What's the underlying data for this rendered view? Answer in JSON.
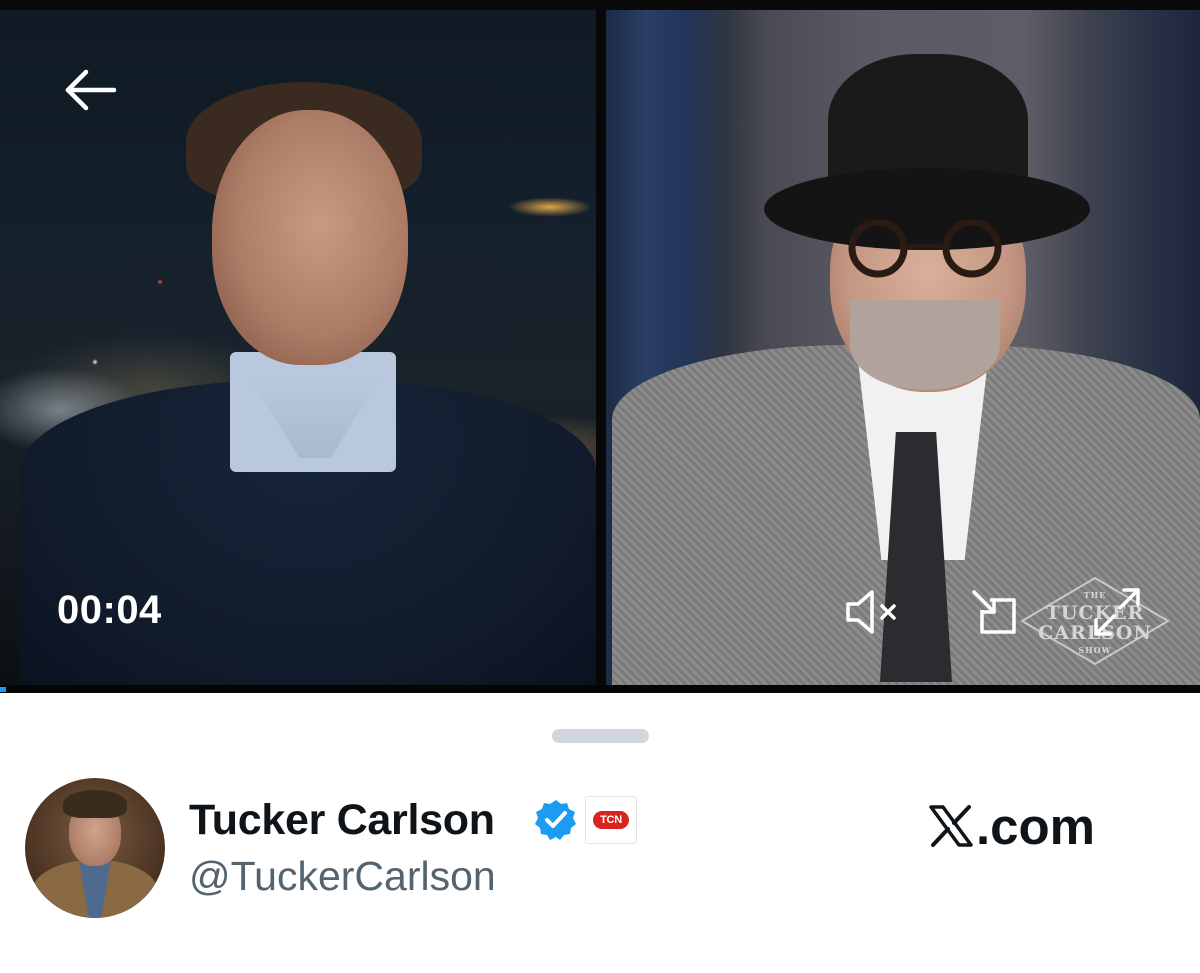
{
  "video": {
    "timestamp": "00:04",
    "progress_fraction": 0.005,
    "watermark": {
      "line1": "THE",
      "line2": "TUCKER",
      "line3": "CARLSON",
      "line4": "SHOW"
    },
    "controls": {
      "back": "arrow-left-icon",
      "mute": "speaker-muted-icon",
      "pip": "picture-in-picture-icon",
      "fullscreen": "expand-icon"
    }
  },
  "account": {
    "display_name": "Tucker Carlson",
    "handle": "@TuckerCarlson",
    "affiliate_badge": "TCN",
    "verified_icon": "verified-badge-icon",
    "verified_color": "#1d9bf0"
  },
  "brand": {
    "label": ".com",
    "logo_icon": "x-logo-icon"
  },
  "colors": {
    "accent": "#1d9bf0",
    "text_primary": "#0f1419",
    "text_secondary": "#536471",
    "affiliate_red": "#d8231f"
  }
}
